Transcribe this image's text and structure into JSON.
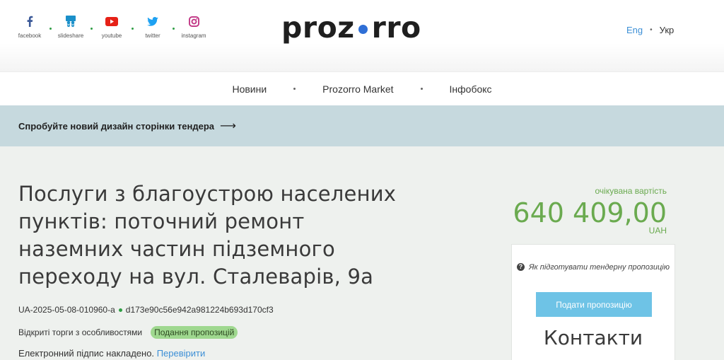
{
  "header": {
    "socials": [
      {
        "label": "facebook",
        "icon": "facebook-icon",
        "color": "#3b5998"
      },
      {
        "label": "slideshare",
        "icon": "slideshare-icon",
        "color": "#1a8fc9"
      },
      {
        "label": "youtube",
        "icon": "youtube-icon",
        "color": "#e62117"
      },
      {
        "label": "twitter",
        "icon": "twitter-icon",
        "color": "#1da1f2"
      },
      {
        "label": "instagram",
        "icon": "instagram-icon",
        "color": "#c13584"
      }
    ],
    "logo": {
      "left": "proz",
      "right": "rro",
      "dot_color": "#2f6fd6"
    },
    "lang": {
      "eng": "Eng",
      "ukr": "Укр"
    }
  },
  "nav": {
    "items": [
      "Новини",
      "Prozorro Market",
      "Інфобокс"
    ]
  },
  "banner": {
    "text": "Спробуйте новий дизайн сторінки тендера",
    "arrow": "⟶"
  },
  "tender": {
    "title": "Послуги з благоустрою населених пунктів: поточний ремонт наземних частин підземного переходу на вул. Сталеварів, 9а",
    "tender_id": "UA-2025-05-08-010960-a",
    "hash": "d173e90c56e942a981224b693d170cf3",
    "procedure": "Відкриті торги з особливостями",
    "status": "Подання пропозицій",
    "signature_text": "Електронний підпис накладено.",
    "signature_link": "Перевірити"
  },
  "value": {
    "label": "очікувана вартість",
    "amount": "640 409,00",
    "currency": "UAH"
  },
  "card": {
    "hint": "Як підготувати тендерну пропозицію",
    "button": "Подати пропозицію",
    "contacts": "Контакти"
  }
}
